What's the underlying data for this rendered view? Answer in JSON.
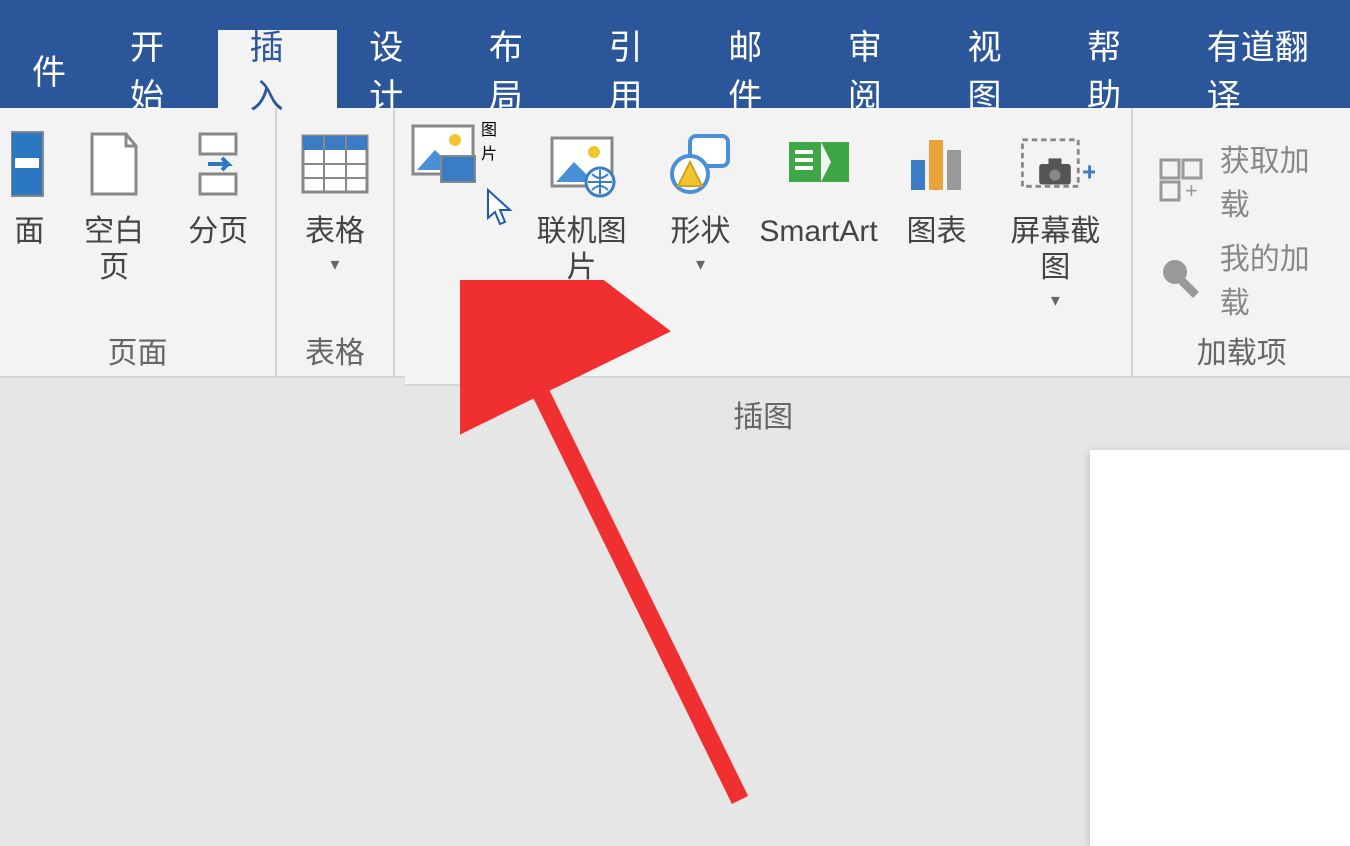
{
  "tabs": {
    "file": "件",
    "home": "开始",
    "insert": "插入",
    "design": "设计",
    "layout": "布局",
    "references": "引用",
    "mailings": "邮件",
    "review": "审阅",
    "view": "视图",
    "help": "帮助",
    "youdao": "有道翻译"
  },
  "ribbon": {
    "pages_group": {
      "label": "页面",
      "cover": "面",
      "blank_page": "空白页",
      "page_break": "分页"
    },
    "tables_group": {
      "label": "表格",
      "table": "表格"
    },
    "illustrations_group": {
      "label": "插图",
      "picture": "图片",
      "online_picture": "联机图片",
      "shapes": "形状",
      "smartart": "SmartArt",
      "chart": "图表",
      "screenshot": "屏幕截图"
    },
    "addins_group": {
      "label": "加载项",
      "get_addins": "获取加载",
      "my_addins": "我的加载"
    }
  }
}
